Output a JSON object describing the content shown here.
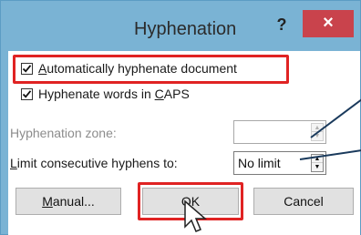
{
  "titlebar": {
    "title": "Hyphenation",
    "help_label": "?",
    "close_label": "×"
  },
  "options": {
    "auto_hyphenate": {
      "label_underlined": "A",
      "label_rest": "utomatically hyphenate document",
      "checked": true
    },
    "hyphenate_caps": {
      "label_start": "Hyphenate words in ",
      "label_underlined": "C",
      "label_end": "APS",
      "checked": true
    }
  },
  "fields": {
    "zone": {
      "label": "Hyphenation zone:",
      "value": "",
      "enabled": false
    },
    "limit": {
      "label_underlined": "L",
      "label_rest": "imit consecutive hyphens to:",
      "value": "No limit",
      "enabled": true
    }
  },
  "buttons": {
    "manual_underlined": "M",
    "manual_rest": "anual...",
    "ok_label": "OK",
    "cancel_label": "Cancel"
  },
  "colors": {
    "highlight": "#e02323",
    "close_button": "#c9434c",
    "frame": "#7ab3d4"
  }
}
